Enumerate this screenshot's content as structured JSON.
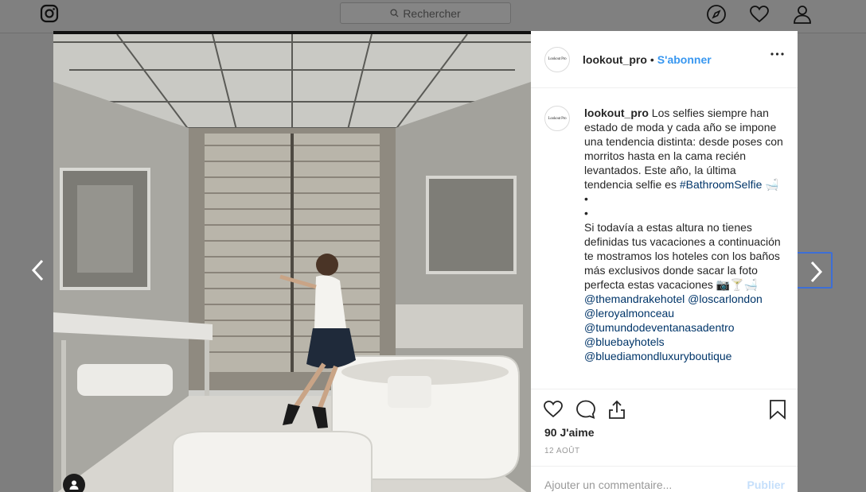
{
  "nav": {
    "search_placeholder": "Rechercher",
    "icons": [
      "instagram-icon",
      "explore-icon",
      "heart-icon",
      "profile-icon"
    ]
  },
  "post": {
    "username": "lookout_pro",
    "separator": "•",
    "follow_label": "S'abonner",
    "avatar_text": "Lookout Pro",
    "caption_text_1": "Los selfies siempre han estado de moda y cada año se impone una tendencia distinta: desde poses con morritos hasta en la cama recién levantados. Este año, la última tendencia selfie es",
    "hashtag": "#BathroomSelfie",
    "emoji_1": "🛁",
    "bullet_1": "•",
    "bullet_2": "•",
    "caption_text_2": "Si todavía a estas altura no tienes definidas tus vacaciones a continuación te mostramos los hoteles con los baños más exclusivos donde sacar la foto perfecta estas vacaciones",
    "emoji_2": "📷🍸🛁",
    "mentions": [
      "@themandrakehotel @loscarlondon",
      "@leroyalmonceau",
      "@tumundodeventanasadentro",
      "@bluebayhotels",
      "@bluediamondluxuryboutique"
    ],
    "likes": "90 J'aime",
    "date": "12 AOÛT",
    "comment_placeholder": "Ajouter un commentaire...",
    "publish_label": "Publier"
  },
  "colors": {
    "accent": "#3897f0",
    "link": "#003569",
    "overlay": "#7e7e7e",
    "focus_ring": "#3d6fd6"
  }
}
